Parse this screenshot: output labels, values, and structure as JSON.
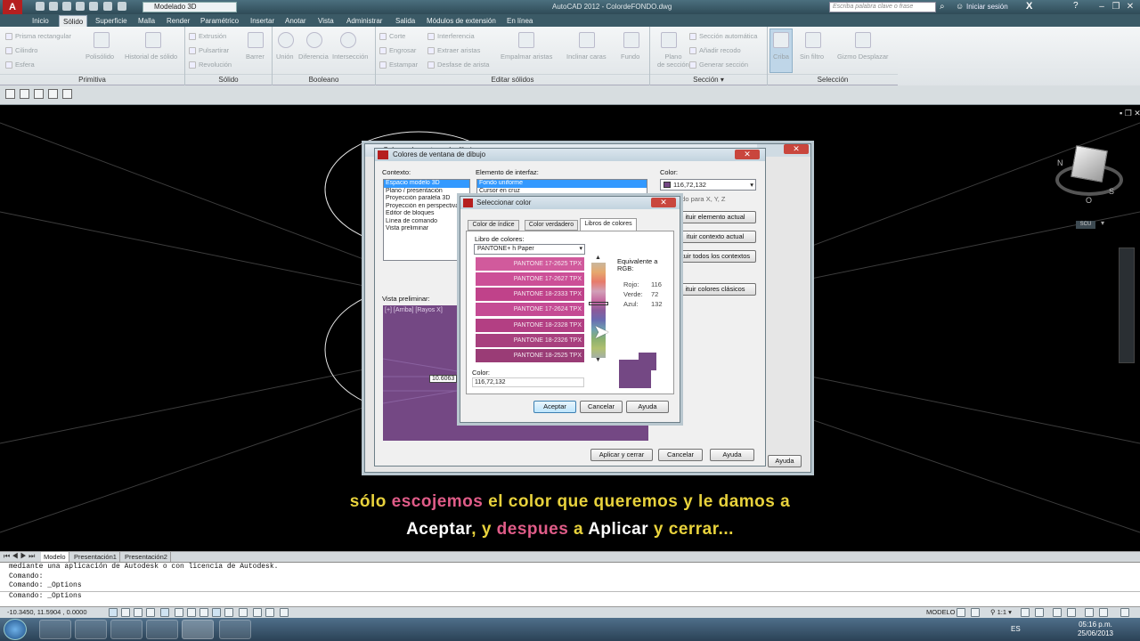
{
  "app": {
    "title": "AutoCAD 2012 - ColordeFONDO.dwg",
    "workspace": "Modelado 3D",
    "search_placeholder": "Escriba palabra clave o frase",
    "login": "Iniciar sesión"
  },
  "ribbon_tabs": [
    "Inicio",
    "Sólido",
    "Superficie",
    "Malla",
    "Render",
    "Paramétrico",
    "Insertar",
    "Anotar",
    "Vista",
    "Administrar",
    "Salida",
    "Módulos de extensión",
    "En línea"
  ],
  "ribbon": {
    "primitiva": {
      "title": "Primitiva",
      "items": [
        "Prisma rectangular",
        "Cilindro",
        "Esfera"
      ],
      "big": [
        "Polisólido",
        "Historial de sólido"
      ]
    },
    "solido": {
      "title": "Sólido",
      "items": [
        "Extrusión",
        "Pulsartirar",
        "Revolución"
      ],
      "big": [
        "Barrer"
      ]
    },
    "booleano": {
      "title": "Booleano",
      "big": [
        "Unión",
        "Diferencia",
        "Intersección"
      ]
    },
    "editar": {
      "title": "Editar sólidos",
      "items": [
        "Corte",
        "Engrosar",
        "Estampar",
        "Interferencia",
        "Extraer aristas",
        "Desfase de arista"
      ],
      "big": [
        "Empalmar aristas",
        "Inclinar caras",
        "Fundo"
      ]
    },
    "seccion": {
      "title": "Sección",
      "items": [
        "Sección automática",
        "Añadir recodo",
        "Generar sección"
      ],
      "big": [
        "Plano de sección"
      ]
    },
    "seleccion": {
      "title": "Selección",
      "big": [
        "Criba",
        "Sin filtro",
        "Gizmo Desplazar"
      ]
    }
  },
  "viewcube": {
    "label": "SCU"
  },
  "dialog_colors": {
    "title": "Colores de ventana de dibujo",
    "context_label": "Contexto:",
    "contexts": [
      "Espacio modelo 3D",
      "Plano / presentación",
      "Proyección paralela 3D",
      "Proyección en perspectiva",
      "Editor de bloques",
      "Línea de comando",
      "Vista preliminar"
    ],
    "element_label": "Elemento de interfaz:",
    "elements": [
      "Fondo uniforme",
      "Cursor en cruz"
    ],
    "color_label": "Color:",
    "color_value": "116,72,132",
    "tint_text": "ado para X, Y, Z",
    "side_buttons": [
      "ituir elemento actual",
      "ituir contexto actual",
      "ituir todos los contextos",
      "ituir colores clásicos"
    ],
    "preview_label": "Vista preliminar:",
    "preview_header": "[+] [Arriba] [Rayos X]",
    "preview_number": "10.6063",
    "apply_button": "Aplicar y cerrar",
    "cancel_button": "Cancelar",
    "help_button": "Ayuda"
  },
  "dialog_select": {
    "title": "Seleccionar color",
    "tabs": [
      "Color de índice",
      "Color verdadero",
      "Libros de colores"
    ],
    "book_label": "Libro de colores:",
    "book_value": "PANTONE+ h Paper",
    "swatches": [
      {
        "name": "PANTONE 17-2625 TPX",
        "color": "#d15a9c"
      },
      {
        "name": "PANTONE 17-2627 TPX",
        "color": "#cc4f97"
      },
      {
        "name": "PANTONE 18-2333 TPX",
        "color": "#c0428a"
      },
      {
        "name": "PANTONE 17-2624 TPX",
        "color": "#c54b94"
      },
      {
        "name": "PANTONE 18-2328 TPX",
        "color": "#b33f83"
      },
      {
        "name": "PANTONE 18-2326 TPX",
        "color": "#a8407e"
      },
      {
        "name": "PANTONE 18-2525 TPX",
        "color": "#9a3c76"
      }
    ],
    "equiv_label": "Equivalente a RGB:",
    "rgb": [
      {
        "k": "Rojo:",
        "v": "116"
      },
      {
        "k": "Verde:",
        "v": "72"
      },
      {
        "k": "Azul:",
        "v": "132"
      }
    ],
    "color_label": "Color:",
    "color_value": "116,72,132",
    "sample_color": "#744884",
    "ok": "Aceptar",
    "cancel": "Cancelar",
    "help": "Ayuda",
    "outer_help": "Ayuda"
  },
  "caption": {
    "line1": [
      {
        "t": "sólo",
        "c": "y"
      },
      {
        "t": " escojemos",
        "c": "r"
      },
      {
        "t": " el color que queremos",
        "c": "y"
      },
      {
        "t": " y le damos a",
        "c": "y"
      }
    ],
    "line2": [
      {
        "t": "Aceptar",
        "c": "w"
      },
      {
        "t": ", y",
        "c": "y"
      },
      {
        "t": " despues",
        "c": "r"
      },
      {
        "t": " a",
        "c": "y"
      },
      {
        "t": " Aplicar",
        "c": "w"
      },
      {
        "t": " y cerrar...",
        "c": "y"
      }
    ]
  },
  "layout_tabs": [
    "Modelo",
    "Presentación1",
    "Presentación2"
  ],
  "command_lines": [
    "mediante una aplicación de Autodesk o con licencia de Autodesk.",
    "Comando:",
    "Comando: _Options",
    "Comando: _Options"
  ],
  "status": {
    "coords": "-10.3450, 11.5904 , 0.0000",
    "space": "MODELO",
    "scale": "1:1"
  },
  "taskbar": {
    "lang": "ES",
    "time": "05:16 p.m.",
    "date": "25/06/2013"
  },
  "colors": {
    "preview_bg": "#744884"
  }
}
